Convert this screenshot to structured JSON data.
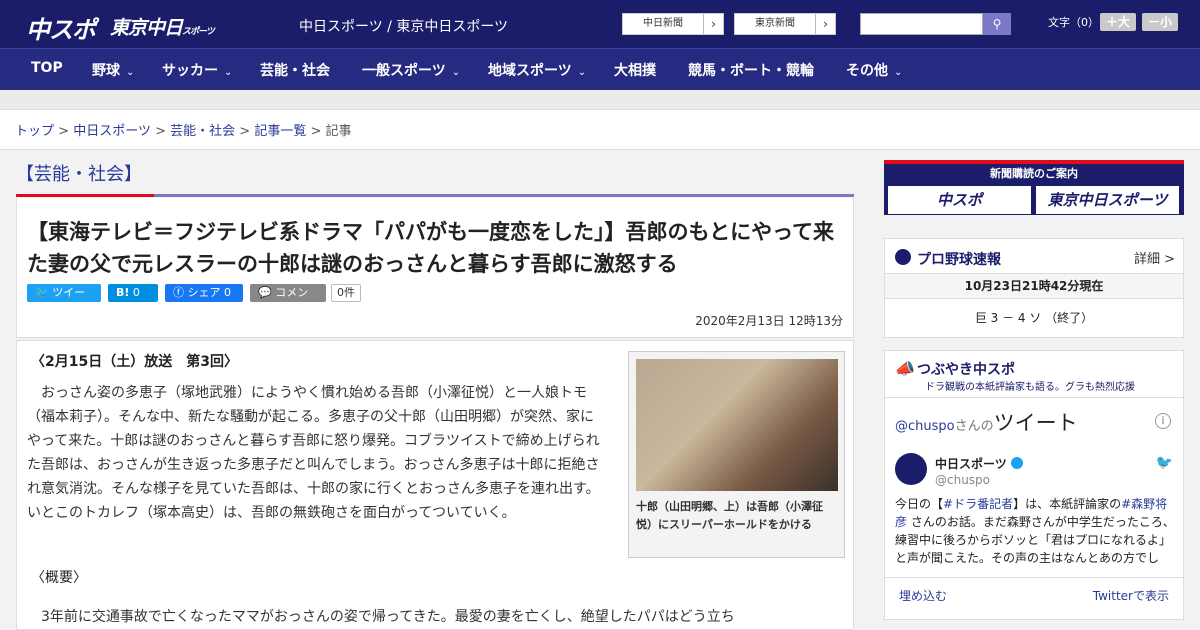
{
  "header": {
    "logo_chuspo": "中スポ",
    "logo_tokyo": "東京中日",
    "logo_tokyo_sub": "スポーツ",
    "site_links": "中日スポーツ / 東京中日スポーツ",
    "newspaper1": "中日新聞",
    "newspaper2": "東京新聞",
    "search_placeholder": "",
    "search_icon": "search-icon",
    "font_size_label": "文字（0）",
    "font_larger": "＋大",
    "font_smaller": "－小"
  },
  "nav": [
    {
      "label": "TOP"
    },
    {
      "label": "野球",
      "chev": "⌄"
    },
    {
      "label": "サッカー",
      "chev": "⌄"
    },
    {
      "label": "芸能・社会"
    },
    {
      "label": "一般スポーツ",
      "chev": "⌄"
    },
    {
      "label": "地域スポーツ",
      "chev": "⌄"
    },
    {
      "label": "大相撲"
    },
    {
      "label": "競馬・ボート・競輪"
    },
    {
      "label": "その他",
      "chev": "⌄"
    }
  ],
  "breadcrumb": {
    "items": [
      "トップ",
      "中日スポーツ",
      "芸能・社会",
      "記事一覧"
    ],
    "sep": ">",
    "current": "記事"
  },
  "category": "【芸能・社会】",
  "article": {
    "title": "【東海テレビ＝フジテレビ系ドラマ「パパがも一度恋をした」】吾郎のもとにやって来た妻の父で元レスラーの十郎は謎のおっさんと暮らす吾郎に激怒する",
    "share": {
      "tweet": "ツイート",
      "hatena": "B!",
      "hatena_count": "0",
      "facebook": "シェア",
      "facebook_count": "0",
      "comment": "コメント",
      "comment_count": "0件"
    },
    "date": "2020年2月13日 12時13分",
    "subhead": "〈2月15日（土）放送　第3回〉",
    "para1": "　おっさん姿の多恵子（塚地武雅）にようやく慣れ始める吾郎（小澤征悦）と一人娘トモ（福本莉子）。そんな中、新たな騒動が起こる。多恵子の父十郎（山田明郷）が突然、家にやって来た。十郎は謎のおっさんと暮らす吾郎に怒り爆発。コブラツイストで締め上げられた吾郎は、おっさんが生き返った多恵子だと叫んでしまう。おっさん多恵子は十郎に拒絶され意気消沈。そんな様子を見ていた吾郎は、十郎の家に行くとおっさん多恵子を連れ出す。いとこのトカレフ（塚本高史）は、吾郎の無鉄砲さを面白がってついていく。",
    "overview_label": "〈概要〉",
    "para2": "　3年前に交通事故で亡くなったママがおっさんの姿で帰ってきた。最愛の妻を亡くし、絶望したパパはどう立ち",
    "photo_caption": "十郎（山田明郷、上）は吾郎（小澤征悦）にスリーパーホールドをかける"
  },
  "sidebar": {
    "subscribe_title": "新聞購読のご案内",
    "subscribe_a": "中スポ",
    "subscribe_b": "東京中日スポーツ",
    "baseball_title": "プロ野球速報",
    "baseball_more": "詳細 >",
    "baseball_time": "10月23日21時42分現在",
    "baseball_score": "巨 3 － 4 ソ （終了）",
    "tsubuyaki_title": "つぶやき中スポ",
    "tsubuyaki_sub": "ドラ観戦の本紙評論家も語る。グラも熱烈応援",
    "tweet_handle": "@chuspo",
    "tweet_mid": "さんの",
    "tweet_word": "ツイート",
    "tweet_name": "中日スポーツ",
    "tweet_user": "@chuspo",
    "tweet_text_a": "今日の【",
    "tweet_tag1": "#ドラ番記者",
    "tweet_text_b": "】は、本紙評論家の",
    "tweet_tag2": "#森野将彦",
    "tweet_text_c": " さんのお話。まだ森野さんが中学生だったころ、練習中に後ろからボソッと「君はプロになれるよ」と声が聞こえた。その声の主はなんとあの方でし",
    "embed": "埋め込む",
    "view_on_twitter": "Twitterで表示"
  }
}
